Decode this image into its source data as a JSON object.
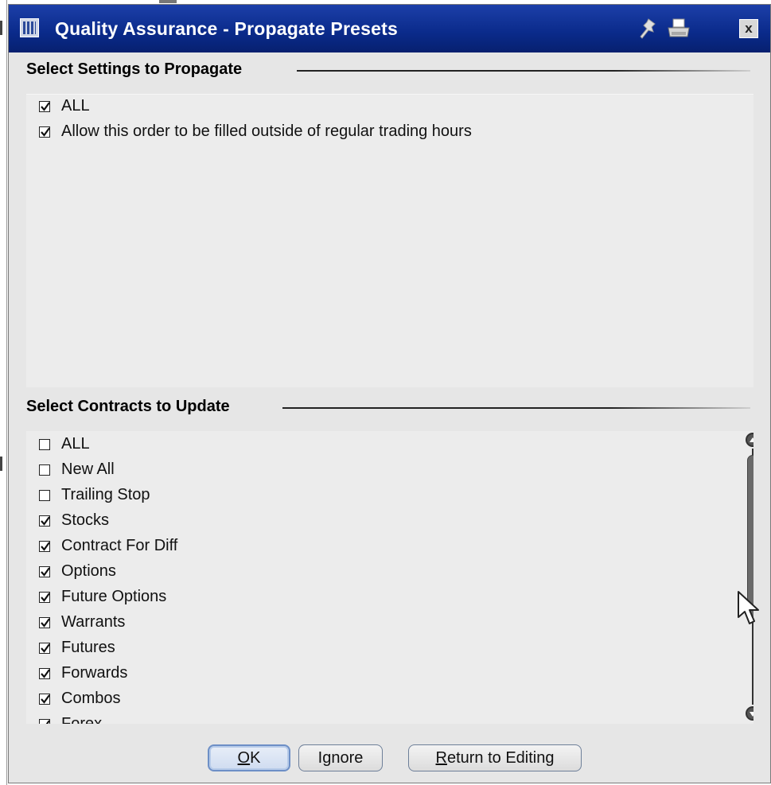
{
  "window": {
    "title": "Quality Assurance - Propagate Presets",
    "icons": [
      "app-icon",
      "pin-icon",
      "print-icon",
      "close-icon"
    ],
    "close_glyph": "x",
    "title_bar_color": "#0a2a8a"
  },
  "settings_section": {
    "heading": "Select Settings to Propagate",
    "items": [
      {
        "label": "ALL",
        "checked": true
      },
      {
        "label": "Allow this order to be filled outside of regular trading hours",
        "checked": true
      }
    ]
  },
  "contracts_section": {
    "heading": "Select Contracts to Update",
    "items": [
      {
        "label": "ALL",
        "checked": false
      },
      {
        "label": "New All",
        "checked": false
      },
      {
        "label": "Trailing Stop",
        "checked": false
      },
      {
        "label": "Stocks",
        "checked": true
      },
      {
        "label": "Contract For Diff",
        "checked": true
      },
      {
        "label": "Options",
        "checked": true
      },
      {
        "label": "Future Options",
        "checked": true
      },
      {
        "label": "Warrants",
        "checked": true
      },
      {
        "label": "Futures",
        "checked": true
      },
      {
        "label": "Forwards",
        "checked": true
      },
      {
        "label": "Combos",
        "checked": true
      },
      {
        "label": "Forex",
        "checked": true
      }
    ]
  },
  "buttons": {
    "ok": {
      "mnemonic": "O",
      "rest": "K"
    },
    "ignore": {
      "label": "Ignore"
    },
    "return": {
      "mnemonic": "R",
      "rest": "eturn to Editing"
    }
  }
}
